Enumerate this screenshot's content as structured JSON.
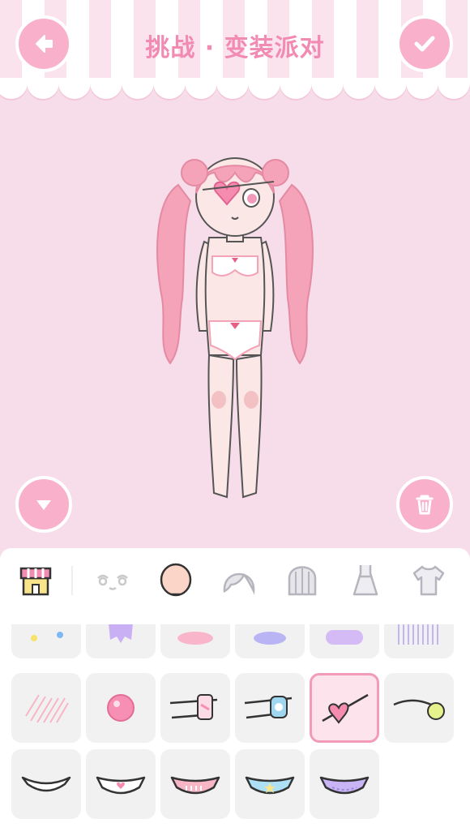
{
  "header": {
    "title": "挑战 · 变装派对"
  },
  "buttons": {
    "back": "back-arrow-icon",
    "confirm": "check-icon",
    "collapse": "triangle-down-icon",
    "trash": "trash-icon"
  },
  "tabs": [
    {
      "name": "shop",
      "icon": "shop-icon",
      "selected": false
    },
    {
      "name": "face",
      "icon": "face-features-icon",
      "selected": false
    },
    {
      "name": "head",
      "icon": "head-icon",
      "selected": true
    },
    {
      "name": "front-hair",
      "icon": "front-hair-icon",
      "selected": false
    },
    {
      "name": "back-hair",
      "icon": "back-hair-icon",
      "selected": false
    },
    {
      "name": "dress",
      "icon": "dress-icon",
      "selected": false
    },
    {
      "name": "top",
      "icon": "shirt-icon",
      "selected": false
    }
  ],
  "items": {
    "selected_index": 10,
    "row1": [
      "cheek-dots",
      "purple-bandage",
      "pink-blush",
      "blue-blush",
      "purple-blush",
      "vertical-lines"
    ],
    "row2": [
      "stripe-blush",
      "pink-nose",
      "bandage-eyepatch",
      "blue-eyepatch",
      "heart-eyepatch",
      "flower-eyepatch"
    ],
    "row3": [
      "white-mask",
      "heart-mask",
      "love-mask",
      "star-mask",
      "purple-mask"
    ]
  },
  "colors": {
    "accent": "#f28bb2",
    "button": "#f9b0cb",
    "background": "#f7dcea"
  }
}
